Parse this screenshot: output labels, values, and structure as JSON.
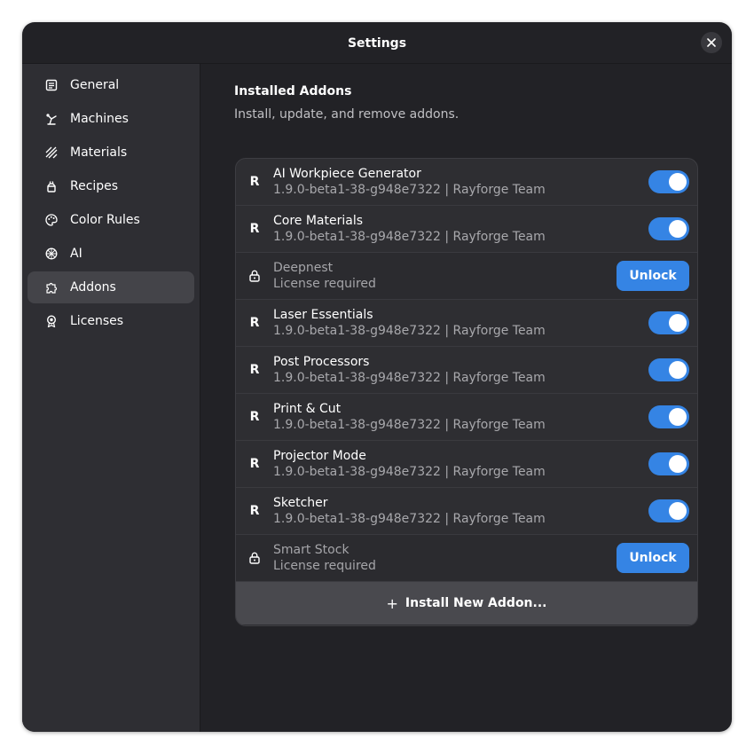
{
  "window": {
    "title": "Settings",
    "close_icon": "close-icon"
  },
  "sidebar": {
    "items": [
      {
        "label": "General",
        "icon": "general-icon",
        "active": false
      },
      {
        "label": "Machines",
        "icon": "machine-icon",
        "active": false
      },
      {
        "label": "Materials",
        "icon": "materials-icon",
        "active": false
      },
      {
        "label": "Recipes",
        "icon": "recipes-icon",
        "active": false
      },
      {
        "label": "Color Rules",
        "icon": "palette-icon",
        "active": false
      },
      {
        "label": "AI",
        "icon": "ai-icon",
        "active": false
      },
      {
        "label": "Addons",
        "icon": "puzzle-icon",
        "active": true
      },
      {
        "label": "Licenses",
        "icon": "license-icon",
        "active": false
      }
    ]
  },
  "main": {
    "section_title": "Installed Addons",
    "section_subtitle": "Install, update, and remove addons.",
    "addons": [
      {
        "icon_glyph": "R",
        "name": "AI Workpiece Generator",
        "subtitle": "1.9.0-beta1-38-g948e7322 | Rayforge Team",
        "locked": false,
        "enabled": true
      },
      {
        "icon_glyph": "R",
        "name": "Core Materials",
        "subtitle": "1.9.0-beta1-38-g948e7322 | Rayforge Team",
        "locked": false,
        "enabled": true
      },
      {
        "icon_glyph": "",
        "name": "Deepnest",
        "subtitle": "License required",
        "locked": true,
        "action_label": "Unlock"
      },
      {
        "icon_glyph": "R",
        "name": "Laser Essentials",
        "subtitle": "1.9.0-beta1-38-g948e7322 | Rayforge Team",
        "locked": false,
        "enabled": true
      },
      {
        "icon_glyph": "R",
        "name": "Post Processors",
        "subtitle": "1.9.0-beta1-38-g948e7322 | Rayforge Team",
        "locked": false,
        "enabled": true
      },
      {
        "icon_glyph": "R",
        "name": "Print & Cut",
        "subtitle": "1.9.0-beta1-38-g948e7322 | Rayforge Team",
        "locked": false,
        "enabled": true
      },
      {
        "icon_glyph": "R",
        "name": "Projector Mode",
        "subtitle": "1.9.0-beta1-38-g948e7322 | Rayforge Team",
        "locked": false,
        "enabled": true
      },
      {
        "icon_glyph": "R",
        "name": "Sketcher",
        "subtitle": "1.9.0-beta1-38-g948e7322 | Rayforge Team",
        "locked": false,
        "enabled": true
      },
      {
        "icon_glyph": "",
        "name": "Smart Stock",
        "subtitle": "License required",
        "locked": true,
        "action_label": "Unlock"
      }
    ],
    "install_label": "Install New Addon..."
  },
  "colors": {
    "accent": "#3584e4",
    "window_bg": "#222226",
    "sidebar_bg": "#2e2e33"
  }
}
